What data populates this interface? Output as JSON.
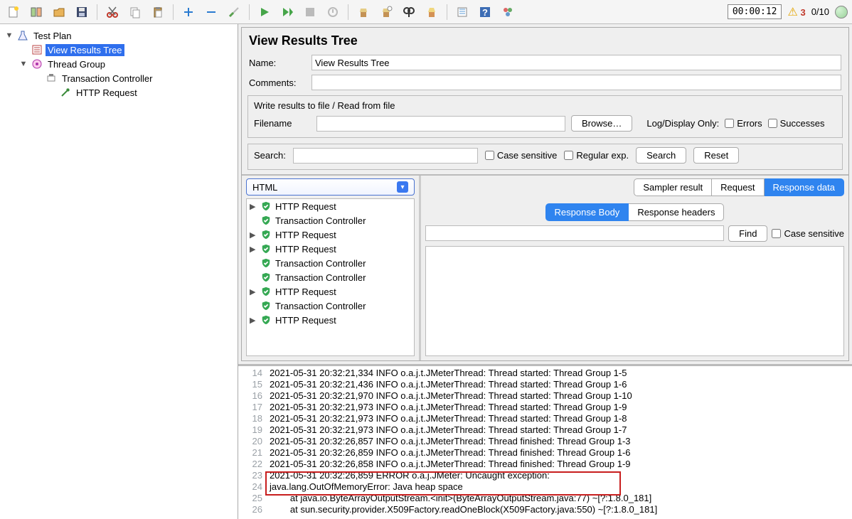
{
  "toolbar_status": {
    "timer": "00:00:12",
    "warn_count": "3",
    "thread_ratio": "0/10"
  },
  "tree": {
    "test_plan": "Test Plan",
    "view_results_tree": "View Results Tree",
    "thread_group": "Thread Group",
    "transaction_controller": "Transaction Controller",
    "http_request": "HTTP Request"
  },
  "panel": {
    "title": "View Results Tree",
    "name_label": "Name:",
    "name_value": "View Results Tree",
    "comments_label": "Comments:",
    "file_group_legend": "Write results to file / Read from file",
    "filename_label": "Filename",
    "browse_btn": "Browse…",
    "log_display_only": "Log/Display Only:",
    "errors_chk": "Errors",
    "successes_chk": "Successes",
    "search_label": "Search:",
    "case_sensitive": "Case sensitive",
    "regex": "Regular exp.",
    "search_btn": "Search",
    "reset_btn": "Reset"
  },
  "results": {
    "renderer": "HTML",
    "samplers": [
      {
        "label": "HTTP Request",
        "expandable": true
      },
      {
        "label": "Transaction Controller",
        "expandable": false
      },
      {
        "label": "HTTP Request",
        "expandable": true
      },
      {
        "label": "HTTP Request",
        "expandable": true
      },
      {
        "label": "Transaction Controller",
        "expandable": false
      },
      {
        "label": "Transaction Controller",
        "expandable": false
      },
      {
        "label": "HTTP Request",
        "expandable": true
      },
      {
        "label": "Transaction Controller",
        "expandable": false
      },
      {
        "label": "HTTP Request",
        "expandable": true
      }
    ],
    "tabs": {
      "sampler_result": "Sampler result",
      "request": "Request",
      "response_data": "Response data"
    },
    "subtabs": {
      "body": "Response Body",
      "headers": "Response headers"
    },
    "find_btn": "Find",
    "find_case": "Case sensitive"
  },
  "log": [
    {
      "n": 14,
      "t": "2021-05-31 20:32:21,334 INFO o.a.j.t.JMeterThread: Thread started: Thread Group 1-5"
    },
    {
      "n": 15,
      "t": "2021-05-31 20:32:21,436 INFO o.a.j.t.JMeterThread: Thread started: Thread Group 1-6"
    },
    {
      "n": 16,
      "t": "2021-05-31 20:32:21,970 INFO o.a.j.t.JMeterThread: Thread started: Thread Group 1-10"
    },
    {
      "n": 17,
      "t": "2021-05-31 20:32:21,973 INFO o.a.j.t.JMeterThread: Thread started: Thread Group 1-9"
    },
    {
      "n": 18,
      "t": "2021-05-31 20:32:21,973 INFO o.a.j.t.JMeterThread: Thread started: Thread Group 1-8"
    },
    {
      "n": 19,
      "t": "2021-05-31 20:32:21,973 INFO o.a.j.t.JMeterThread: Thread started: Thread Group 1-7"
    },
    {
      "n": 20,
      "t": "2021-05-31 20:32:26,857 INFO o.a.j.t.JMeterThread: Thread finished: Thread Group 1-3"
    },
    {
      "n": 21,
      "t": "2021-05-31 20:32:26,859 INFO o.a.j.t.JMeterThread: Thread finished: Thread Group 1-6"
    },
    {
      "n": 22,
      "t": "2021-05-31 20:32:26,858 INFO o.a.j.t.JMeterThread: Thread finished: Thread Group 1-9"
    },
    {
      "n": 23,
      "t": "2021-05-31 20:32:26,859 ERROR o.a.j.JMeter: Uncaught exception: "
    },
    {
      "n": 24,
      "t": "java.lang.OutOfMemoryError: Java heap space"
    },
    {
      "n": 25,
      "t": "        at java.io.ByteArrayOutputStream.<init>(ByteArrayOutputStream.java:77) ~[?:1.8.0_181]"
    },
    {
      "n": 26,
      "t": "        at sun.security.provider.X509Factory.readOneBlock(X509Factory.java:550) ~[?:1.8.0_181]"
    }
  ]
}
